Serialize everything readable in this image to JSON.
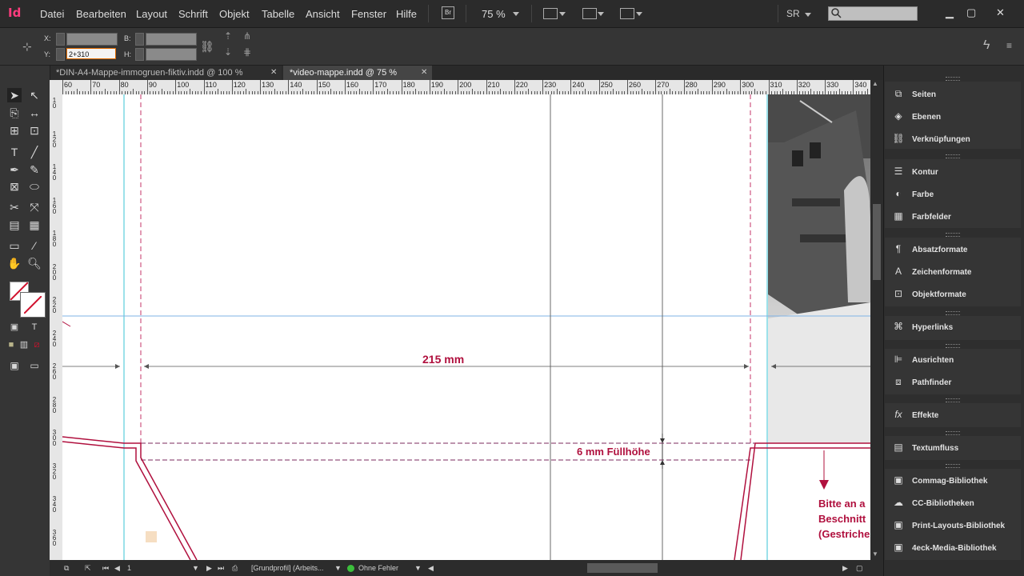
{
  "app": {
    "logo": "Id"
  },
  "menu": [
    "Datei",
    "Bearbeiten",
    "Layout",
    "Schrift",
    "Objekt",
    "Tabelle",
    "Ansicht",
    "Fenster",
    "Hilfe"
  ],
  "menubar": {
    "br_label": "Br",
    "zoom": "75 %",
    "profile": "SR"
  },
  "control": {
    "x_label": "X:",
    "y_label": "Y:",
    "b_label": "B:",
    "h_label": "H:",
    "y_value": "2+310"
  },
  "tabs": [
    {
      "label": "*DIN-A4-Mappe-immogruen-fiktiv.indd @ 100 %"
    },
    {
      "label": "*video-mappe.indd @ 75 %"
    }
  ],
  "ruler": {
    "top_numbers": [
      "60",
      "70",
      "80",
      "90",
      "100",
      "110",
      "120",
      "130",
      "140",
      "150",
      "160",
      "170",
      "180",
      "190",
      "200",
      "210",
      "220",
      "230",
      "240",
      "250",
      "260",
      "270",
      "280",
      "290",
      "300",
      "310",
      "320",
      "330",
      "340"
    ]
  },
  "ruler_left": [
    "1 0",
    "1 2 0",
    "1 4 0",
    "1 6 0",
    "1 8 0",
    "2 0 0",
    "2 2 0",
    "2 4 0",
    "2 6 0",
    "2 8 0",
    "3 0 0",
    "3 2 0",
    "3 4 0",
    "3 6 0"
  ],
  "canvas": {
    "dim_215": "215 mm",
    "dim_6": "6 mm Füllhöhe",
    "note_lines": [
      "Bitte an a",
      "Beschnitt",
      "(Gestriche"
    ]
  },
  "status": {
    "page": "1",
    "profile": "[Grundprofil] (Arbeits...",
    "errors": "Ohne Fehler"
  },
  "panel": {
    "groups": [
      [
        "Seiten",
        "Ebenen",
        "Verknüpfungen"
      ],
      [
        "Kontur",
        "Farbe",
        "Farbfelder"
      ],
      [
        "Absatzformate",
        "Zeichenformate",
        "Objektformate"
      ],
      [
        "Hyperlinks"
      ],
      [
        "Ausrichten",
        "Pathfinder"
      ],
      [
        "Effekte"
      ],
      [
        "Textumfluss"
      ],
      [
        "Commag-Bibliothek",
        "CC-Bibliotheken",
        "Print-Layouts-Bibliothek",
        "4eck-Media-Bibliothek"
      ]
    ]
  },
  "colors": {
    "accent": "#b0103e",
    "guide": "#39c3d6",
    "logo": "#ff3c7e"
  }
}
